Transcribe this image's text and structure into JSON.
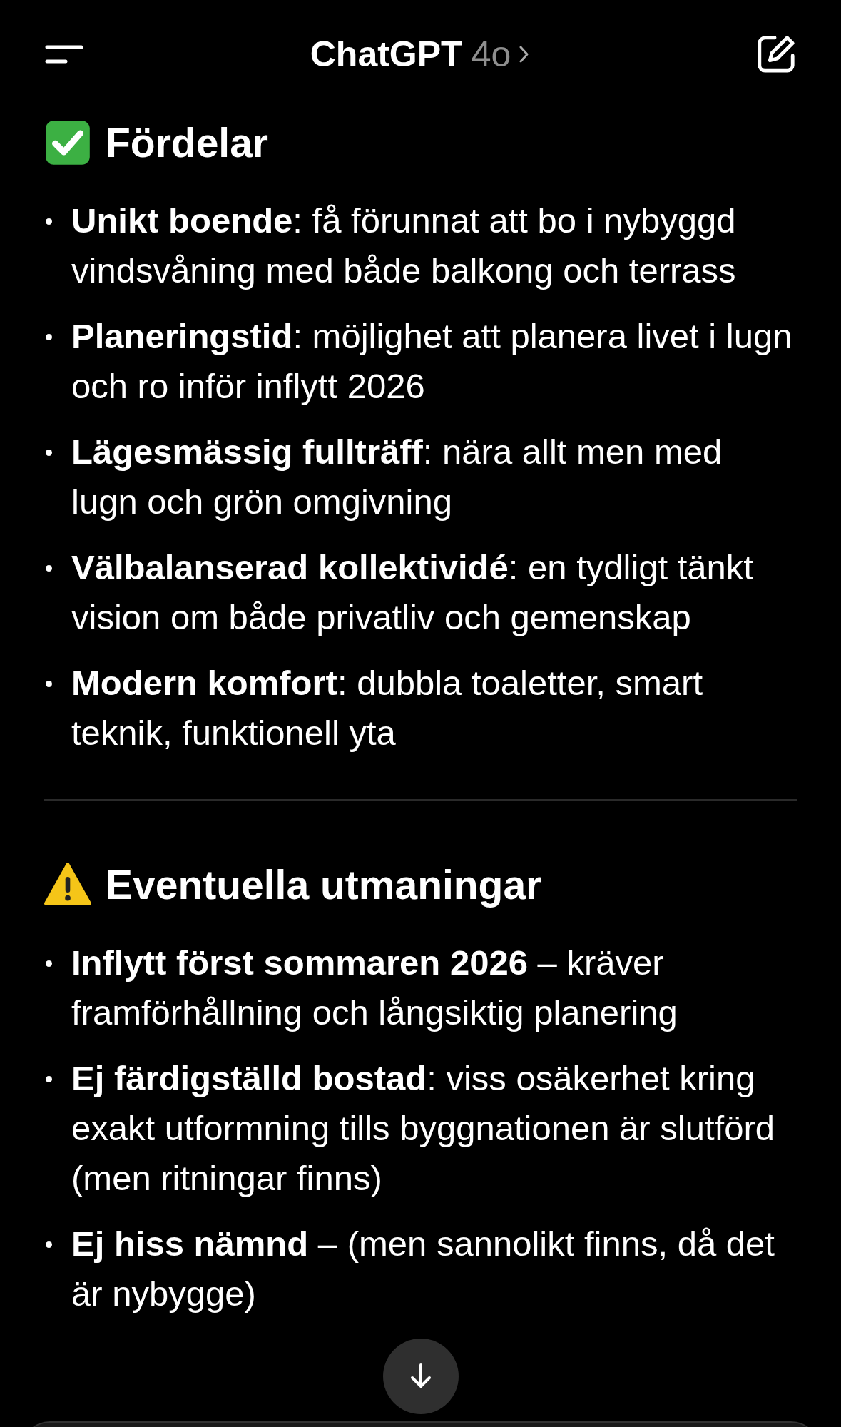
{
  "header": {
    "title": "ChatGPT",
    "model": "4o"
  },
  "sections": [
    {
      "kind": "check",
      "heading": "Fördelar",
      "items": [
        "**Unikt boende**: få förunnat att bo i nybyggd vindsvåning med både balkong och terrass",
        "**Planeringstid**: möjlighet att planera livet i lugn och ro inför inflytt 2026",
        "**Lägesmässig fullträff**: nära allt men med lugn och grön omgivning",
        "**Välbalanserad kollektividé**: en tydligt tänkt vision om både privatliv och gemenskap",
        "**Modern komfort**: dubbla toaletter, smart teknik, funktionell yta"
      ]
    },
    {
      "kind": "warning",
      "heading": "Eventuella utmaningar",
      "items": [
        "**Inflytt först sommaren 2026** – kräver framförhållning och långsiktig planering",
        "**Ej färdigställd bostad**: viss osäkerhet kring exakt utformning tills byggnationen är slutförd (men ritningar finns)",
        "**Ej hiss nämnd** – (men sannolikt finns, då det är nybygge)"
      ]
    }
  ]
}
